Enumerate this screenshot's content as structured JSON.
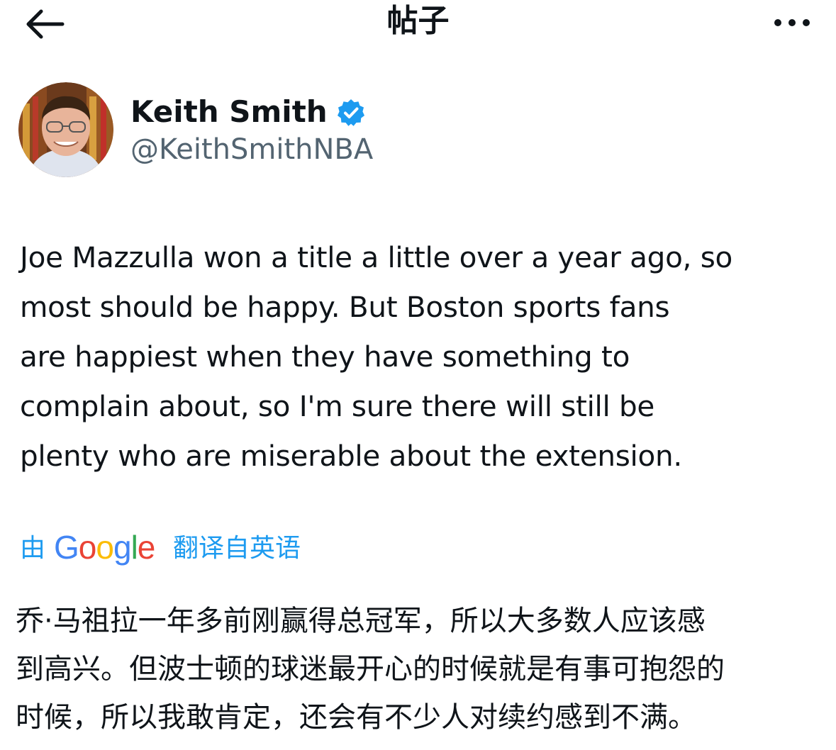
{
  "header": {
    "title": "帖子",
    "back_icon": "arrow-left-icon",
    "more_icon": "more-horizontal-icon"
  },
  "author": {
    "display_name": "Keith Smith",
    "handle": "@KeithSmithNBA",
    "verified": true,
    "verified_color": "#1d9bf0"
  },
  "tweet": {
    "lines": [
      "Joe Mazzulla won a title a little over a year ago, so",
      "most should be happy. But Boston sports fans",
      "are happiest when they have something to",
      "complain about, so I'm sure there will still be",
      "plenty who are miserable about the extension."
    ]
  },
  "translation": {
    "prefix": "由",
    "provider": "Google",
    "suffix": "翻译自英语",
    "link_color": "#1d9bf0",
    "lines": [
      "乔·马祖拉一年多前刚赢得总冠军，所以大多数人应该感",
      "到高兴。但波士顿的球迷最开心的时候就是有事可抱怨的",
      "时候，所以我敢肯定，还会有不少人对续约感到不满。"
    ]
  }
}
